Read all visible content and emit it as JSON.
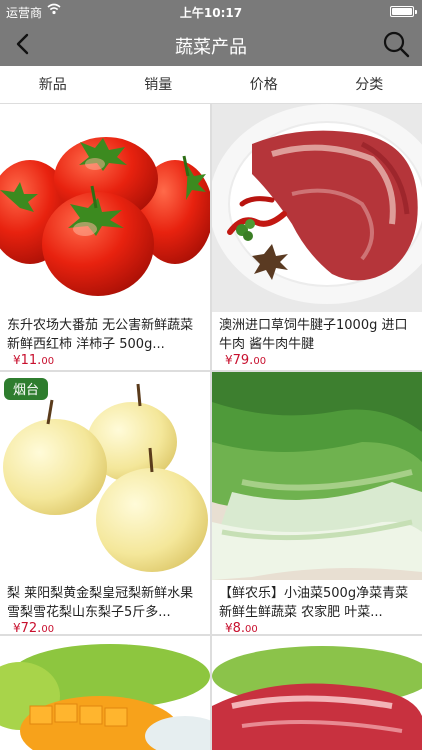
{
  "status": {
    "carrier": "运营商",
    "time": "上午10:17"
  },
  "header": {
    "title": "蔬菜产品"
  },
  "tabs": [
    {
      "label": "新品"
    },
    {
      "label": "销量"
    },
    {
      "label": "价格"
    },
    {
      "label": "分类"
    }
  ],
  "products": [
    {
      "name": "东升农场大番茄 无公害新鲜蔬菜 新鲜西红柿 洋柿子 500g...",
      "currency": "¥",
      "price_main": "11.",
      "price_cents": "00"
    },
    {
      "name": "澳洲进口草饲牛腱子1000g 进口牛肉 酱牛肉牛腱",
      "currency": "¥",
      "price_main": "79.",
      "price_cents": "00"
    },
    {
      "name": "梨 莱阳梨黄金梨皇冠梨新鲜水果 雪梨雪花梨山东梨子5斤多...",
      "currency": "¥",
      "price_main": "72.",
      "price_cents": "00",
      "logo_text": "烟台"
    },
    {
      "name": "【鲜农乐】小油菜500g净菜青菜 新鲜生鲜蔬菜 农家肥 叶菜...",
      "currency": "¥",
      "price_main": "8.",
      "price_cents": "00"
    }
  ],
  "colors": {
    "nav_bg": "#7a7a7a",
    "price": "#c8102e"
  },
  "icons": [
    "back-arrow-icon",
    "search-icon",
    "wifi-icon",
    "battery-icon"
  ]
}
